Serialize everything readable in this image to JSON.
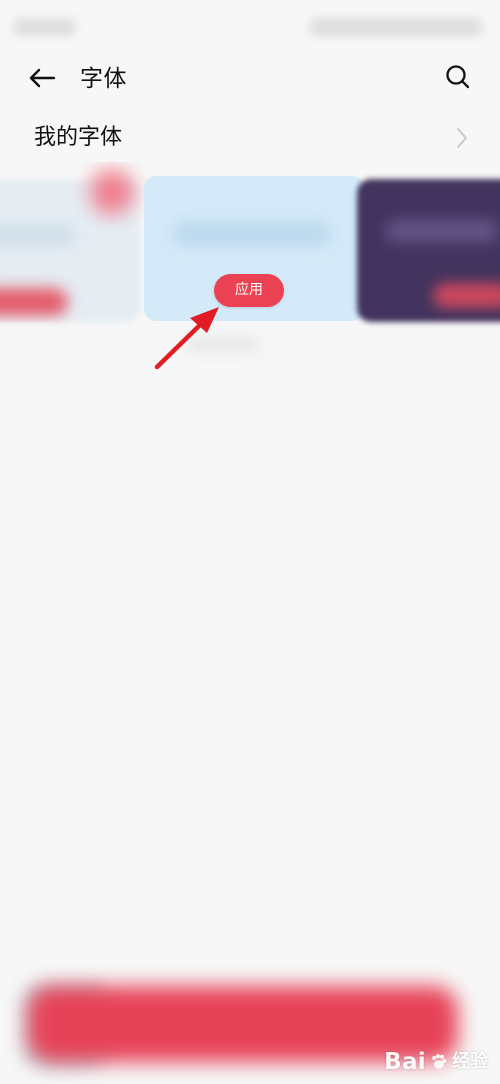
{
  "header": {
    "title": "字体",
    "back_icon": "arrow-left-icon",
    "search_icon": "search-icon"
  },
  "my_fonts": {
    "label": "我的字体",
    "chevron_icon": "chevron-right-icon"
  },
  "carousel": {
    "apply_label": "应用"
  },
  "watermark": {
    "logo": "Bai",
    "suffix": "经验"
  },
  "colors": {
    "background": "#f7f7f7",
    "accent": "#ea4252",
    "arrow": "#e11c24",
    "center_card": "#d4eaf8"
  }
}
